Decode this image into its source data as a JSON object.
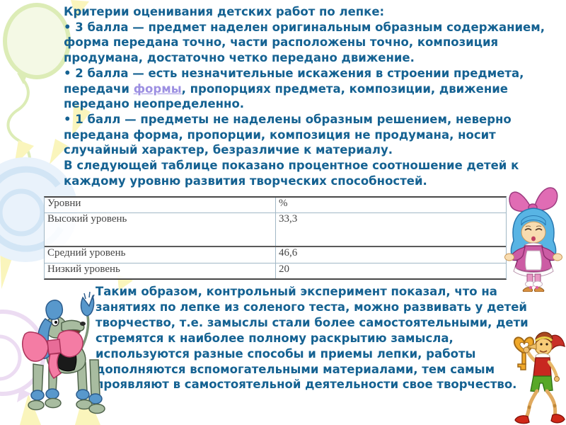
{
  "slide": {
    "bg_color": "#ffffff",
    "text_color": "#156292",
    "link_color": "#9d90e2"
  },
  "criteria": {
    "title": "Критерии оценивания детских работ по лепке:",
    "bullet3": "• 3 балла — предмет наделен оригинальным образным содержанием, форма передана точно, части расположены точно, композиция продумана, достаточно четко передано движение.",
    "bullet2_pre": "• 2 балла — есть незначительные искажения в строении предмета, передачи ",
    "bullet2_link": "формы",
    "bullet2_post": ", пропорциях предмета, композиции, движение передано неопределенно.",
    "bullet1": "• 1 балл — предметы не наделены образным решением, неверно передана форма, пропорции, композиция не продумана, носит случайный характер, безразличие к материалу.",
    "table_intro": "В следующей таблице показано процентное соотношение детей к каждому уровню развития творческих способностей."
  },
  "results_table": {
    "col_headers": [
      "Уровни",
      "%"
    ],
    "rows": [
      {
        "level": "Высокий уровень",
        "percent": "33,3"
      },
      {
        "level": "Средний уровень",
        "percent": "46,6"
      },
      {
        "level": "Низкий уровень",
        "percent": "20"
      }
    ]
  },
  "conclusion": "Таким образом, контрольный эксперимент показал, что на занятиях по лепке из соленого теста, можно развивать у детей творчество, т.е. замыслы стали более самостоятельными, дети стремятся к наиболее полному раскрытию замысла, используются разные способы и приемы лепки, работы дополняются вспомогательными материалами, тем самым проявляют в самостоятельной деятельности свое творчество.",
  "decorations": {
    "top_left_icon": "green-balloon-icon",
    "middle_left_icon": "blue-balloon-icon",
    "lower_left_icon": "purple-balloon-icon",
    "sparkles_icon": "yellow-ray-triangles-icon",
    "right_icon": "doll-with-pink-bow-icon",
    "bottom_left_icon": "poodle-with-pink-bow-icon",
    "bottom_right_icon": "buratino-with-golden-key-icon"
  }
}
